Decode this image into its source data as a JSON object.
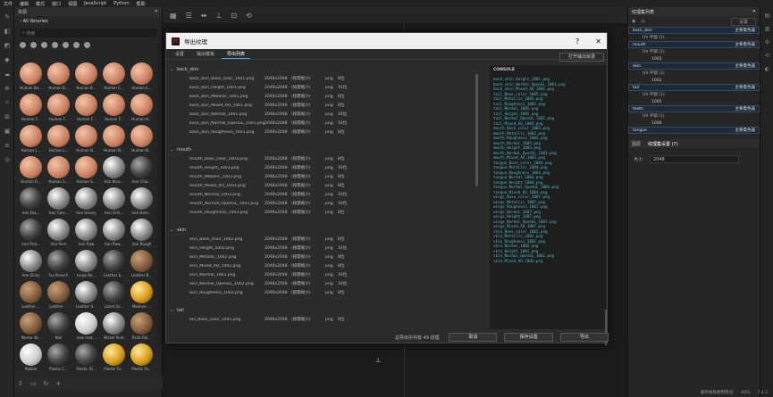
{
  "menubar": [
    "文件",
    "编辑",
    "模式",
    "窗口",
    "视图",
    "JavaScript",
    "Python",
    "帮助"
  ],
  "shelf": {
    "title": "资源",
    "path": "All libraries",
    "search_placeholder": "搜索",
    "items": [
      {
        "label": "Human Ba...",
        "kind": "skin"
      },
      {
        "label": "Human B...",
        "kind": "skin"
      },
      {
        "label": "Human B...",
        "kind": "skin"
      },
      {
        "label": "Human C...",
        "kind": "skin"
      },
      {
        "label": "Human E...",
        "kind": "skin"
      },
      {
        "label": "Human F...",
        "kind": "skin"
      },
      {
        "label": "Human F...",
        "kind": "skin"
      },
      {
        "label": "Human F...",
        "kind": "skin"
      },
      {
        "label": "Human F...",
        "kind": "skin"
      },
      {
        "label": "Human H...",
        "kind": "skin"
      },
      {
        "label": "Human L...",
        "kind": "skin"
      },
      {
        "label": "Human L...",
        "kind": "skin"
      },
      {
        "label": "Human N...",
        "kind": "skin"
      },
      {
        "label": "Human N...",
        "kind": "skin"
      },
      {
        "label": "Human N...",
        "kind": "skin"
      },
      {
        "label": "Human R...",
        "kind": "skin"
      },
      {
        "label": "Human S...",
        "kind": "skin"
      },
      {
        "label": "Human S...",
        "kind": "skin"
      },
      {
        "label": "Iron Brus...",
        "kind": "metal"
      },
      {
        "label": "Iron Chai...",
        "kind": "dark"
      },
      {
        "label": "Iron Dia...",
        "kind": "dark"
      },
      {
        "label": "Iron Galv...",
        "kind": "metal"
      },
      {
        "label": "Iron Grainy",
        "kind": "metal"
      },
      {
        "label": "Iron Grin...",
        "kind": "metal"
      },
      {
        "label": "Iron Ham...",
        "kind": "metal"
      },
      {
        "label": "Iron Pow...",
        "kind": "dark"
      },
      {
        "label": "Iron Pure",
        "kind": "metal"
      },
      {
        "label": "Iron Raw",
        "kind": "metal"
      },
      {
        "label": "Iron Raw...",
        "kind": "metal"
      },
      {
        "label": "Iron Rough",
        "kind": "metal"
      },
      {
        "label": "Iron Shiny",
        "kind": "metal"
      },
      {
        "label": "Ivy Branch",
        "kind": "dark"
      },
      {
        "label": "Large Ro...",
        "kind": "metal"
      },
      {
        "label": "Leather b...",
        "kind": "dark"
      },
      {
        "label": "Leather B...",
        "kind": "wood"
      },
      {
        "label": "Leather ...",
        "kind": "wood"
      },
      {
        "label": "Leather ...",
        "kind": "wood"
      },
      {
        "label": "Leather S...",
        "kind": "metal"
      },
      {
        "label": "Lizard Sc...",
        "kind": "dark"
      },
      {
        "label": "Medium ...",
        "kind": "gold"
      },
      {
        "label": "Mortar W...",
        "kind": "wood"
      },
      {
        "label": "Nail",
        "kind": "dark"
      },
      {
        "label": "new mat...",
        "kind": "white"
      },
      {
        "label": "Nickel Pure",
        "kind": "metal"
      },
      {
        "label": "Paint Rol...",
        "kind": "wood"
      },
      {
        "label": "Pebble",
        "kind": "white"
      },
      {
        "label": "Plastic C...",
        "kind": "dark"
      },
      {
        "label": "Plastic Di...",
        "kind": "dark"
      },
      {
        "label": "Plastic Fa...",
        "kind": "gold"
      },
      {
        "label": "Plastic Fa...",
        "kind": "gold"
      }
    ]
  },
  "right_panel": {
    "title": "纹理集列表",
    "dropdown": "设置",
    "layers": [
      {
        "name": "back_skin",
        "shader": "主要着色器",
        "uv": "UV 平铺 (1)",
        "tile": ""
      },
      {
        "name": "mouth",
        "shader": "主要着色器",
        "uv": "UV 平铺 (1)",
        "tile": "1003"
      },
      {
        "name": "skin",
        "shader": "主要着色器",
        "uv": "UV 平铺 (1)",
        "tile": "1002"
      },
      {
        "name": "tail",
        "shader": "主要着色器",
        "uv": "UV 平铺 (1)",
        "tile": "1005"
      },
      {
        "name": "teeth",
        "shader": "主要着色器",
        "uv": "UV 平铺 (1)",
        "tile": "1006"
      },
      {
        "name": "tongue",
        "shader": "主要着色器",
        "uv": "",
        "tile": ""
      }
    ],
    "props_tabs": [
      "图层",
      "纹理集设置 (7)"
    ],
    "size_label": "大小",
    "size_value": "2048"
  },
  "status": {
    "text": "缓存磁盘使用情况:",
    "percent": "60%",
    "version": "7.4.3"
  },
  "dialog": {
    "title": "导出纹理",
    "help": "?",
    "close": "✕",
    "tabs": [
      "设置",
      "输出模板",
      "导出列表"
    ],
    "active_tab": 2,
    "open_folder": "打开输出目录",
    "console_header": "CONSOLE",
    "groups": [
      {
        "name": "back_skin",
        "files": [
          {
            "f": "back_skin_Base_color_1001.png",
            "r": "2048x2048",
            "s": "(按需缩小)",
            "t": "png",
            "b": "8位"
          },
          {
            "f": "back_skin_Height_1001.png",
            "r": "2048x2048",
            "s": "(按需缩小)",
            "t": "png",
            "b": "16位"
          },
          {
            "f": "back_skin_Metallic_1001.png",
            "r": "2048x2048",
            "s": "(按需缩小)",
            "t": "png",
            "b": "8位"
          },
          {
            "f": "back_skin_Mixed_AO_1001.png",
            "r": "2048x2048",
            "s": "(按需缩小)",
            "t": "png",
            "b": "8位"
          },
          {
            "f": "back_skin_Normal_1001.png",
            "r": "2048x2048",
            "s": "(按需缩小)",
            "t": "png",
            "b": "16位"
          },
          {
            "f": "back_skin_Normal_OpenGL_1001.png",
            "r": "2048x2048",
            "s": "(按需缩小)",
            "t": "png",
            "b": "16位"
          },
          {
            "f": "back_skin_Roughness_1001.png",
            "r": "2048x2048",
            "s": "(按需缩小)",
            "t": "png",
            "b": "8位"
          }
        ]
      },
      {
        "name": "mouth",
        "files": [
          {
            "f": "mouth_Base_color_1003.png",
            "r": "2048x2048",
            "s": "(按需缩小)",
            "t": "png",
            "b": "8位"
          },
          {
            "f": "mouth_Height_1003.png",
            "r": "2048x2048",
            "s": "(按需缩小)",
            "t": "png",
            "b": "16位"
          },
          {
            "f": "mouth_Metallic_1003.png",
            "r": "2048x2048",
            "s": "(按需缩小)",
            "t": "png",
            "b": "8位"
          },
          {
            "f": "mouth_Mixed_AO_1003.png",
            "r": "2048x2048",
            "s": "(按需缩小)",
            "t": "png",
            "b": "8位"
          },
          {
            "f": "mouth_Normal_1003.png",
            "r": "2048x2048",
            "s": "(按需缩小)",
            "t": "png",
            "b": "16位"
          },
          {
            "f": "mouth_Normal_OpenGL_1003.png",
            "r": "2048x2048",
            "s": "(按需缩小)",
            "t": "png",
            "b": "16位"
          },
          {
            "f": "mouth_Roughness_1003.png",
            "r": "2048x2048",
            "s": "(按需缩小)",
            "t": "png",
            "b": "8位"
          }
        ]
      },
      {
        "name": "skin",
        "files": [
          {
            "f": "skin_Base_color_1002.png",
            "r": "2048x2048",
            "s": "(按需缩小)",
            "t": "png",
            "b": "8位"
          },
          {
            "f": "skin_Height_1002.png",
            "r": "2048x2048",
            "s": "(按需缩小)",
            "t": "png",
            "b": "16位"
          },
          {
            "f": "skin_Metallic_1002.png",
            "r": "2048x2048",
            "s": "(按需缩小)",
            "t": "png",
            "b": "8位"
          },
          {
            "f": "skin_Mixed_AO_1002.png",
            "r": "2048x2048",
            "s": "(按需缩小)",
            "t": "png",
            "b": "8位"
          },
          {
            "f": "skin_Normal_1002.png",
            "r": "2048x2048",
            "s": "(按需缩小)",
            "t": "png",
            "b": "16位"
          },
          {
            "f": "skin_Normal_OpenGL_1002.png",
            "r": "2048x2048",
            "s": "(按需缩小)",
            "t": "png",
            "b": "16位"
          },
          {
            "f": "skin_Roughness_1002.png",
            "r": "2048x2048",
            "s": "(按需缩小)",
            "t": "png",
            "b": "8位"
          }
        ]
      },
      {
        "name": "tail",
        "files": [
          {
            "f": "tail_Base_color_1005.png",
            "r": "2048x2048",
            "s": "(按需缩小)",
            "t": "png",
            "b": "8位"
          }
        ]
      }
    ],
    "console_lines": [
      "back_skin_Height_1001.png",
      "back_skin_Normal_OpenGL_1001.png",
      "back_skin_Mixed_AO_1001.png",
      "tail_Base_color_1005.png",
      "tail_Metallic_1005.png",
      "tail_Roughness_1005.png",
      "tail_Normal_1005.png",
      "tail_Height_1005.png",
      "tail_Normal_OpenGL_1005.png",
      "tail_Mixed_AO_1005.png",
      "mouth_Base_color_1003.png",
      "mouth_Metallic_1003.png",
      "mouth_Roughness_1003.png",
      "mouth_Normal_1003.png",
      "mouth_Height_1003.png",
      "mouth_Normal_OpenGL_1003.png",
      "mouth_Mixed_AO_1003.png",
      "tongue_Base_color_1004.png",
      "tongue_Metallic_1004.png",
      "tongue_Roughness_1004.png",
      "tongue_Normal_1004.png",
      "tongue_Height_1004.png",
      "tongue_Normal_OpenGL_1004.png",
      "tongue_Mixed_AO_1004.png",
      "wings_Base_color_1007.png",
      "wings_Metallic_1007.png",
      "wings_Roughness_1007.png",
      "wings_Normal_1007.png",
      "wings_Height_1007.png",
      "wings_Normal_OpenGL_1007.png",
      "wings_Mixed_AO_1007.png",
      "skin_Base_color_1002.png",
      "skin_Metallic_1002.png",
      "skin_Roughness_1002.png",
      "skin_Normal_1002.png",
      "skin_Height_1002.png",
      "skin_Normal_OpenGL_1002.png",
      "skin_Mixed_AO_1002.png"
    ],
    "footer": {
      "count": "总导出中共有 49 纹理",
      "cancel": "取消",
      "save": "保存设置",
      "export": "导出"
    }
  }
}
